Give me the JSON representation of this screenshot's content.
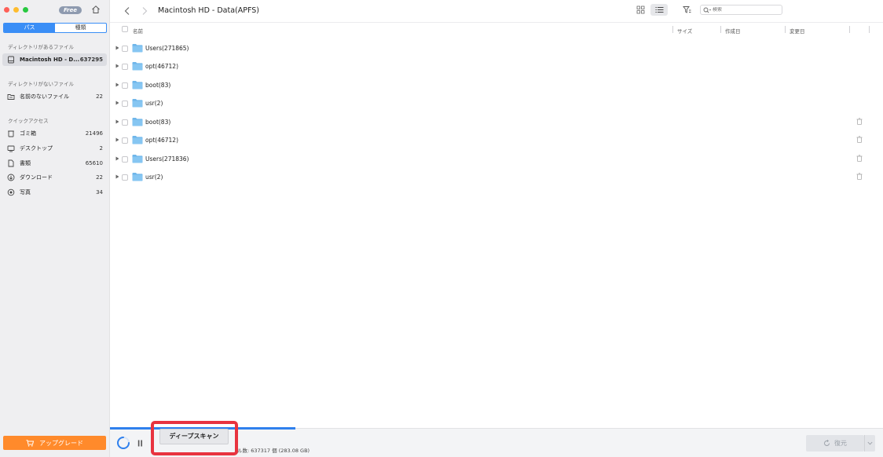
{
  "window": {
    "badge": "Free"
  },
  "sidebar": {
    "tabs": [
      {
        "label": "パス",
        "active": true
      },
      {
        "label": "種類",
        "active": false
      }
    ],
    "sections": [
      {
        "title": "ディレクトリがあるファイル",
        "items": [
          {
            "label": "Macintosh HD - D...",
            "count": "637295",
            "icon": "drive-icon",
            "selected": true
          }
        ]
      },
      {
        "title": "ディレクトリがないファイル",
        "items": [
          {
            "label": "名前のないファイル",
            "count": "22",
            "icon": "folder-outline-icon",
            "selected": false
          }
        ]
      },
      {
        "title": "クイックアクセス",
        "items": [
          {
            "label": "ゴミ箱",
            "count": "21496",
            "icon": "trash-icon",
            "selected": false
          },
          {
            "label": "デスクトップ",
            "count": "2",
            "icon": "desktop-icon",
            "selected": false
          },
          {
            "label": "書類",
            "count": "65610",
            "icon": "document-icon",
            "selected": false
          },
          {
            "label": "ダウンロード",
            "count": "22",
            "icon": "download-icon",
            "selected": false
          },
          {
            "label": "写真",
            "count": "34",
            "icon": "photo-icon",
            "selected": false
          }
        ]
      }
    ],
    "upgrade_label": "アップグレード"
  },
  "toolbar": {
    "breadcrumb": "Macintosh HD - Data(APFS)",
    "search_placeholder": "検索"
  },
  "list": {
    "columns": {
      "name": "名前",
      "size": "サイズ",
      "created": "作成日",
      "modified": "変更日"
    },
    "rows": [
      {
        "name": "Users(271865)",
        "deletable": false
      },
      {
        "name": "opt(46712)",
        "deletable": false
      },
      {
        "name": "boot(83)",
        "deletable": false
      },
      {
        "name": "usr(2)",
        "deletable": false
      },
      {
        "name": "boot(83)",
        "deletable": true
      },
      {
        "name": "opt(46712)",
        "deletable": true
      },
      {
        "name": "Users(271836)",
        "deletable": true
      },
      {
        "name": "usr(2)",
        "deletable": true
      }
    ]
  },
  "footer": {
    "scan_progress": 0.24,
    "deep_scan_label": "ディープスキャン",
    "status_text": "ル数: 637317 個 (283.08 GB)",
    "recover_label": "復元"
  },
  "colors": {
    "accent": "#3a8ef6",
    "upgrade": "#ff8a2b",
    "highlight": "#e8333f",
    "progress": "#2f80ed",
    "folder": "#6fb6ea"
  }
}
